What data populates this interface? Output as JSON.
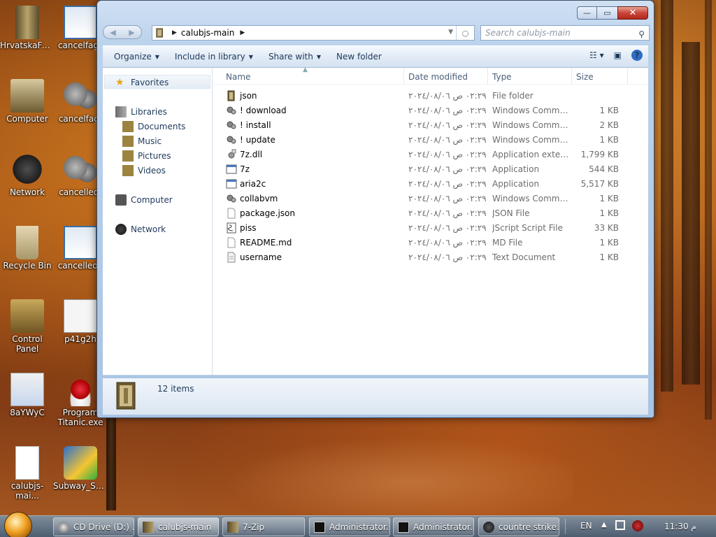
{
  "desktop": {
    "icons": [
      {
        "label": "HrvatskaFu...",
        "icon": "book-icon"
      },
      {
        "label": "cancelfag_",
        "icon": "window-icon"
      },
      {
        "label": "Computer",
        "icon": "computer-icon"
      },
      {
        "label": "cancelfag-",
        "icon": "gears-icon"
      },
      {
        "label": "Network",
        "icon": "network-icon"
      },
      {
        "label": "cancelled-",
        "icon": "gears-icon"
      },
      {
        "label": "Recycle Bin",
        "icon": "recycle-bin-icon"
      },
      {
        "label": "cancellede",
        "icon": "window-icon"
      },
      {
        "label": "Control Panel",
        "icon": "control-panel-icon"
      },
      {
        "label": "p41g2h",
        "icon": "sketch-image-icon"
      },
      {
        "label": "8aYWyC",
        "icon": "people-image-icon"
      },
      {
        "label": "Program\nTitanic.exe",
        "icon": "program-icon"
      },
      {
        "label": "calubjs-mai...",
        "icon": "blank-file-icon"
      },
      {
        "label": "Subway_Sur...",
        "icon": "game-icon"
      }
    ]
  },
  "window": {
    "title_buttons": {
      "minimize": "—",
      "maximize": "▭",
      "close": "✕"
    },
    "address": {
      "path": "calubjs-main"
    },
    "search": {
      "placeholder": "Search calubjs-main"
    },
    "toolbar": {
      "organize": "Organize",
      "include_in_library": "Include in library",
      "share_with": "Share with",
      "new_folder": "New folder"
    },
    "nav": {
      "favorites": "Favorites",
      "libraries": "Libraries",
      "documents": "Documents",
      "music": "Music",
      "pictures": "Pictures",
      "videos": "Videos",
      "computer": "Computer",
      "network": "Network"
    },
    "columns": {
      "name": "Name",
      "date": "Date modified",
      "type": "Type",
      "size": "Size"
    },
    "files": [
      {
        "name": "json",
        "date": "٠٢:٢٩ ص ٢٠٢٤/٠٨/٠٦",
        "type": "File folder",
        "size": "",
        "icon": "folder-icon"
      },
      {
        "name": "! download",
        "date": "٠٢:٢٩ ص ٢٠٢٤/٠٨/٠٦",
        "type": "Windows Comma...",
        "size": "1 KB",
        "icon": "batch-icon"
      },
      {
        "name": "! install",
        "date": "٠٢:٢٩ ص ٢٠٢٤/٠٨/٠٦",
        "type": "Windows Comma...",
        "size": "2 KB",
        "icon": "batch-icon"
      },
      {
        "name": "! update",
        "date": "٠٢:٢٩ ص ٢٠٢٤/٠٨/٠٦",
        "type": "Windows Comma...",
        "size": "1 KB",
        "icon": "batch-icon"
      },
      {
        "name": "7z.dll",
        "date": "٠٢:٢٩ ص ٢٠٢٤/٠٨/٠٦",
        "type": "Application extens...",
        "size": "1,799 KB",
        "icon": "dll-icon"
      },
      {
        "name": "7z",
        "date": "٠٢:٢٩ ص ٢٠٢٤/٠٨/٠٦",
        "type": "Application",
        "size": "544 KB",
        "icon": "application-icon"
      },
      {
        "name": "aria2c",
        "date": "٠٢:٢٩ ص ٢٠٢٤/٠٨/٠٦",
        "type": "Application",
        "size": "5,517 KB",
        "icon": "application-icon"
      },
      {
        "name": "collabvm",
        "date": "٠٢:٢٩ ص ٢٠٢٤/٠٨/٠٦",
        "type": "Windows Comma...",
        "size": "1 KB",
        "icon": "batch-icon"
      },
      {
        "name": "package.json",
        "date": "٠٢:٢٩ ص ٢٠٢٤/٠٨/٠٦",
        "type": "JSON File",
        "size": "1 KB",
        "icon": "blank-file-icon"
      },
      {
        "name": "piss",
        "date": "٠٢:٢٩ ص ٢٠٢٤/٠٨/٠٦",
        "type": "JScript Script File",
        "size": "33 KB",
        "icon": "script-icon"
      },
      {
        "name": "README.md",
        "date": "٠٢:٢٩ ص ٢٠٢٤/٠٨/٠٦",
        "type": "MD File",
        "size": "1 KB",
        "icon": "blank-file-icon"
      },
      {
        "name": "username",
        "date": "٠٢:٢٩ ص ٢٠٢٤/٠٨/٠٦",
        "type": "Text Document",
        "size": "1 KB",
        "icon": "text-icon"
      }
    ],
    "status": {
      "count": "12 items"
    }
  },
  "taskbar": {
    "buttons": [
      {
        "label": "CD Drive (D:) ...",
        "icon": "cd-icon"
      },
      {
        "label": "calubjs-main",
        "icon": "folder-icon"
      },
      {
        "label": "7-Zip",
        "icon": "folder-icon"
      },
      {
        "label": "Administrator...",
        "icon": "cmd-icon"
      },
      {
        "label": "Administrator...",
        "icon": "cmd-icon"
      },
      {
        "label": "countre strike...",
        "icon": "steam-icon"
      }
    ],
    "tray": {
      "lang": "EN",
      "time": "11:30 م"
    }
  }
}
